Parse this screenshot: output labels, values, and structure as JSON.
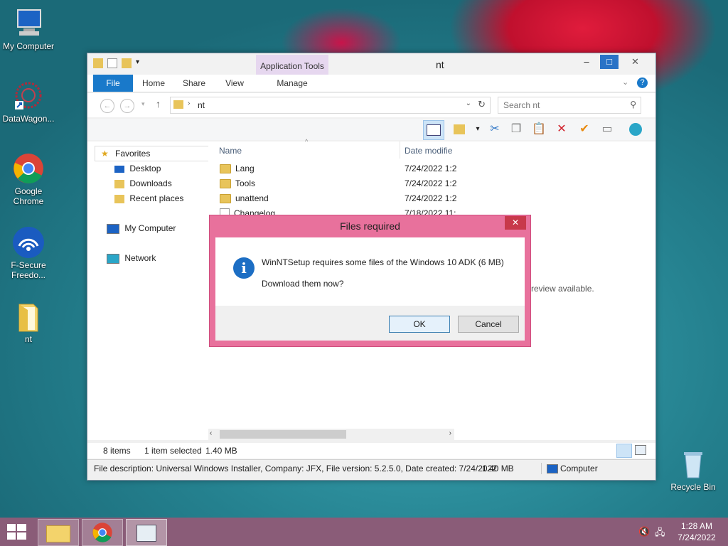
{
  "desktop": {
    "icons": [
      {
        "label": "My Computer"
      },
      {
        "label": "DataWagon..."
      },
      {
        "label": "Google Chrome"
      },
      {
        "label": "F-Secure Freedo..."
      },
      {
        "label": "nt"
      },
      {
        "label": "Recycle Bin"
      }
    ]
  },
  "window": {
    "title": "nt",
    "context_tab": "Application Tools",
    "tabs": [
      "File",
      "Home",
      "Share",
      "View",
      "Manage"
    ],
    "address": "nt",
    "search_placeholder": "Search nt",
    "nav": {
      "favorites": "Favorites",
      "desktop": "Desktop",
      "downloads": "Downloads",
      "recent": "Recent places",
      "computer": "My Computer",
      "network": "Network"
    },
    "columns": {
      "name": "Name",
      "date": "Date modifie"
    },
    "files": [
      {
        "name": "Lang",
        "date": "7/24/2022 1:2"
      },
      {
        "name": "Tools",
        "date": "7/24/2022 1:2"
      },
      {
        "name": "unattend",
        "date": "7/24/2022 1:2"
      },
      {
        "name": "Changelog",
        "date": "7/18/2022 11:"
      }
    ],
    "preview_text": "review available.",
    "status": {
      "items": "8 items",
      "selected": "1 item selected",
      "size": "1.40 MB"
    },
    "infobar": {
      "description": "File description: Universal Windows Installer, Company: JFX, File version: 5.2.5.0, Date created: 7/24/2022",
      "size": "1.40 MB",
      "location": "Computer"
    }
  },
  "dialog": {
    "title": "Files required",
    "message": "WinNTSetup requires some files of the Windows 10 ADK (6 MB)",
    "question": "Download them now?",
    "ok": "OK",
    "cancel": "Cancel"
  },
  "taskbar": {
    "time": "1:28 AM",
    "date": "7/24/2022"
  }
}
